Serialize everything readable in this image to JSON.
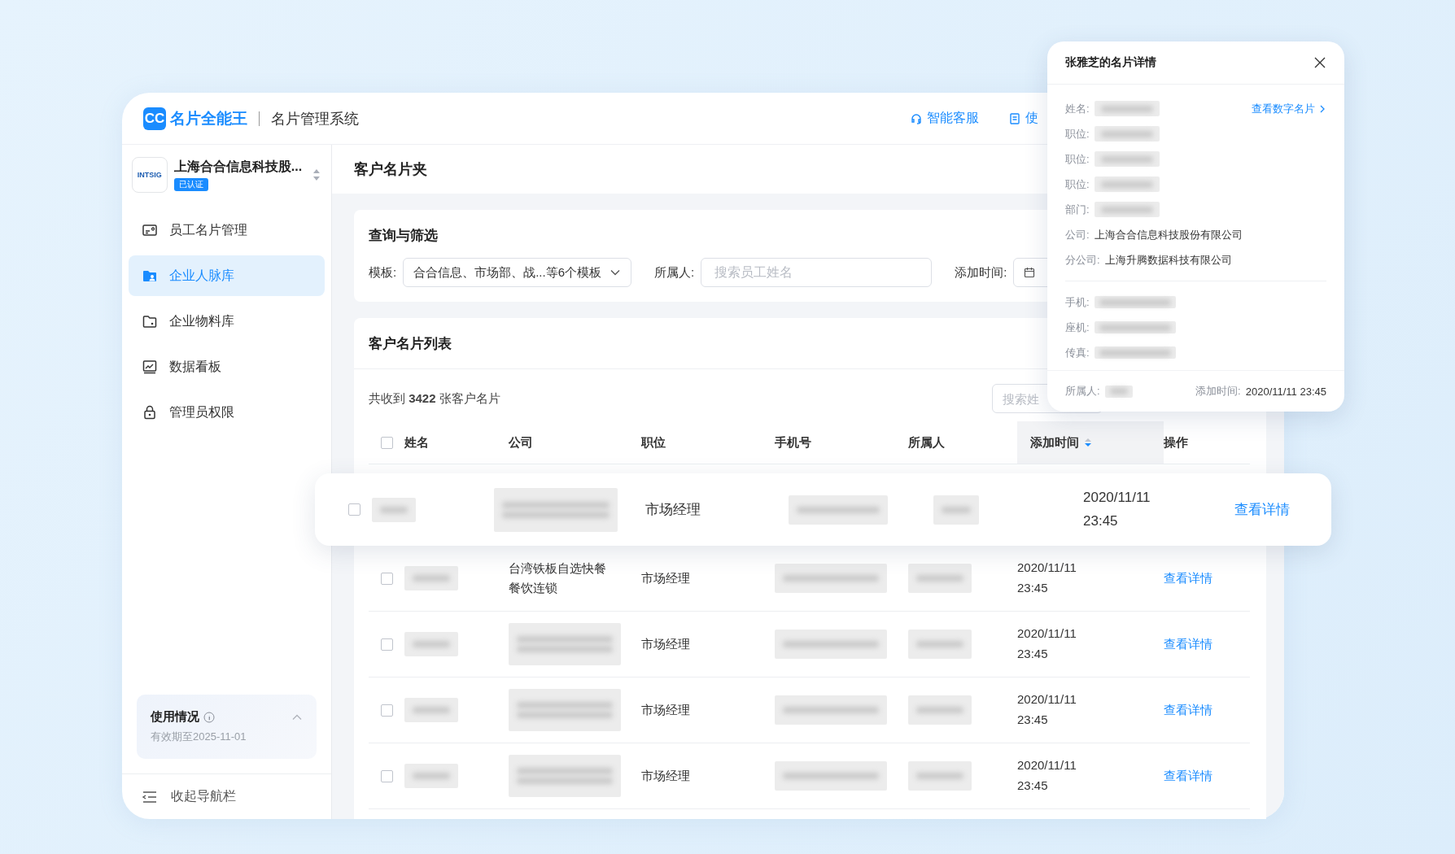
{
  "header": {
    "logo_mark": "CC",
    "brand": "名片全能王",
    "system": "名片管理系统",
    "links": [
      {
        "label": "智能客服",
        "kind": "service"
      },
      {
        "label": "使",
        "kind": "doc"
      }
    ]
  },
  "sidebar": {
    "company": {
      "logo": "INTSIG",
      "name": "上海合合信息科技股...",
      "badge": "已认证"
    },
    "items": [
      {
        "label": "员工名片管理",
        "kind": "card",
        "selected": false
      },
      {
        "label": "企业人脉库",
        "kind": "contacts",
        "selected": true
      },
      {
        "label": "企业物料库",
        "kind": "folder",
        "selected": false
      },
      {
        "label": "数据看板",
        "kind": "chart",
        "selected": false
      },
      {
        "label": "管理员权限",
        "kind": "lock",
        "selected": false
      }
    ],
    "usage": {
      "title": "使用情况",
      "expiry": "有效期至2025-11-01",
      "expanded": true
    },
    "collapse": "收起导航栏"
  },
  "page_title": "客户名片夹",
  "filter": {
    "title": "查询与筛选",
    "template_label": "模板:",
    "template_value": "合合信息、市场部、战...等6个模板",
    "owner_label": "所属人:",
    "owner_placeholder": "搜索员工姓名",
    "time_label": "添加时间:"
  },
  "list": {
    "title": "客户名片列表",
    "summary": "共收到 **3422** 张客户名片",
    "search_placeholder": "搜索姓",
    "select_all_checked": false,
    "columns": [
      {
        "label": "姓名",
        "sorted": false
      },
      {
        "label": "公司",
        "sorted": false
      },
      {
        "label": "职位",
        "sorted": false
      },
      {
        "label": "手机号",
        "sorted": false
      },
      {
        "label": "所属人",
        "sorted": false
      },
      {
        "label": "添加时间",
        "sorted": true
      },
      {
        "label": "操作",
        "sorted": false
      }
    ],
    "rows": [
      {
        "lifted": true,
        "checked": false,
        "position": "市场经理",
        "time": "2020/11/11 23:45",
        "action": "查看详情"
      },
      {
        "lifted": false,
        "checked": false,
        "company": "台湾铁板自选快餐餐饮连锁",
        "position": "市场经理",
        "time": "2020/11/11 23:45",
        "action": "查看详情"
      },
      {
        "lifted": false,
        "checked": false,
        "position": "市场经理",
        "time": "2020/11/11 23:45",
        "action": "查看详情"
      },
      {
        "lifted": false,
        "checked": false,
        "position": "市场经理",
        "time": "2020/11/11 23:45",
        "action": "查看详情"
      },
      {
        "lifted": false,
        "checked": false,
        "position": "市场经理",
        "time": "2020/11/11 23:45",
        "action": "查看详情"
      }
    ]
  },
  "detail": {
    "title": "张雅芝的名片详情",
    "link": "查看数字名片",
    "fields": [
      {
        "label": "姓名:",
        "kind": "blurred"
      },
      {
        "label": "职位:",
        "kind": "blurred"
      },
      {
        "label": "职位:",
        "kind": "blurred"
      },
      {
        "label": "职位:",
        "kind": "blurred"
      },
      {
        "label": "部门:",
        "kind": "blurred"
      },
      {
        "label": "公司:",
        "kind": "text",
        "value": "上海合合信息科技股份有限公司"
      },
      {
        "label": "分公司:",
        "kind": "text",
        "value": "上海升腾数据科技有限公司"
      }
    ],
    "contacts": [
      {
        "label": "手机:"
      },
      {
        "label": "座机:"
      },
      {
        "label": "传真:"
      }
    ],
    "owner_label": "所属人:",
    "time_label": "添加时间:",
    "time_value": "2020/11/11 23:45"
  }
}
